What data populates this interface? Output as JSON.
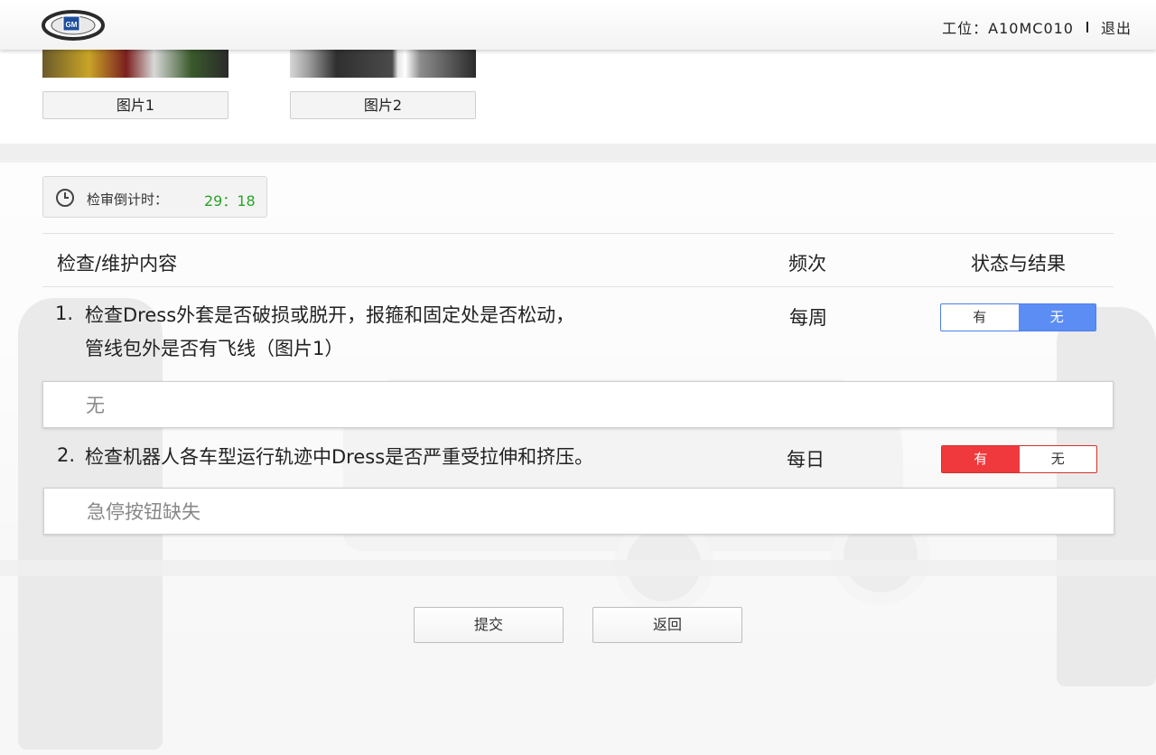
{
  "header": {
    "logo_text": "GM",
    "station": "工位：A10MC010",
    "logout": "退出"
  },
  "images": {
    "items": [
      {
        "label": "图片1"
      },
      {
        "label": "图片2"
      }
    ]
  },
  "countdown": {
    "label": "检审倒计时：",
    "time": "29：18"
  },
  "table": {
    "headers": {
      "content": "检查/维护内容",
      "frequency": "频次",
      "status": "状态与结果"
    },
    "rows": [
      {
        "number": "1.",
        "text_line1": "检查Dress外套是否破损或脱开，报箍和固定处是否松动，",
        "text_line2": "管线包外是否有飞线（图片1）",
        "frequency": "每周",
        "option_yes": "有",
        "option_no": "无",
        "selected": "无",
        "note": "无"
      },
      {
        "number": "2.",
        "text_line1": "检查机器人各车型运行轨迹中Dress是否严重受拉伸和挤压。",
        "frequency": "每日",
        "option_yes": "有",
        "option_no": "无",
        "selected": "有",
        "note": "急停按钮缺失"
      }
    ]
  },
  "actions": {
    "submit": "提交",
    "back": "返回"
  },
  "colors": {
    "selected_no": "#5b8df5",
    "selected_yes": "#f0393c",
    "countdown": "#29a329"
  }
}
